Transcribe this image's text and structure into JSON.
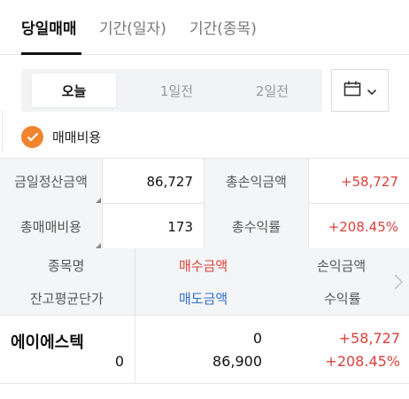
{
  "top_tabs": {
    "today_trade": "당일매매",
    "period_daily": "기간(일자)",
    "period_stock": "기간(종목)"
  },
  "segment": {
    "today": "오늘",
    "day1": "1일전",
    "day2": "2일전"
  },
  "fee": {
    "label": "매매비용",
    "checked": true
  },
  "summary": {
    "today_settlement_label": "금일정산금액",
    "today_settlement_value": "86,727",
    "total_pnl_label": "총손익금액",
    "total_pnl_value": "+58,727",
    "total_fee_label": "총매매비용",
    "total_fee_value": "173",
    "total_return_label": "총수익률",
    "total_return_value": "+208.45%"
  },
  "list_header": {
    "stock_name": "종목명",
    "buy_amount": "매수금액",
    "pnl_amount": "손익금액",
    "balance_avg_price": "잔고평균단가",
    "sell_amount": "매도금액",
    "return_rate": "수익률"
  },
  "rows": [
    {
      "stock_name": "에이에스텍",
      "balance_avg_price": "0",
      "buy_amount": "0",
      "sell_amount": "86,900",
      "pnl_amount": "+58,727",
      "return_rate": "+208.45%"
    }
  ],
  "colors": {
    "accent_orange": "#f0852e",
    "profit_red": "#d9413a",
    "sell_blue": "#2f6fc8"
  },
  "icons": {
    "date_picker": "calendar-icon",
    "dropdown": "chevron-down-icon",
    "scroll_more": "chevron-right-icon",
    "fee_checkbox": "checkmark-icon"
  }
}
